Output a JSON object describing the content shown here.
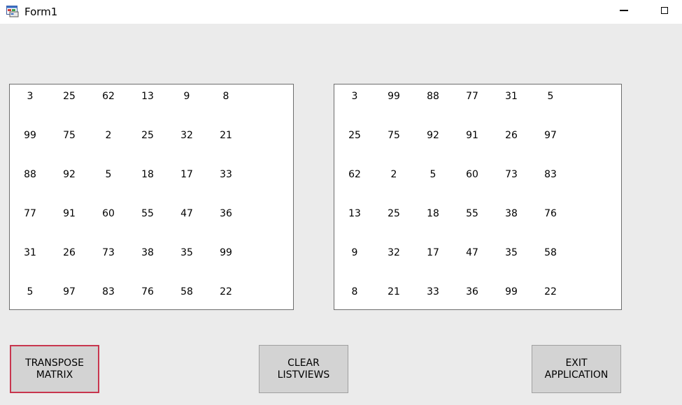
{
  "window": {
    "title": "Form1"
  },
  "left_listview": {
    "rows": [
      [
        "3",
        "25",
        "62",
        "13",
        "9",
        "8"
      ],
      [
        "99",
        "75",
        "2",
        "25",
        "32",
        "21"
      ],
      [
        "88",
        "92",
        "5",
        "18",
        "17",
        "33"
      ],
      [
        "77",
        "91",
        "60",
        "55",
        "47",
        "36"
      ],
      [
        "31",
        "26",
        "73",
        "38",
        "35",
        "99"
      ],
      [
        "5",
        "97",
        "83",
        "76",
        "58",
        "22"
      ]
    ]
  },
  "right_listview": {
    "rows": [
      [
        "3",
        "99",
        "88",
        "77",
        "31",
        "5"
      ],
      [
        "25",
        "75",
        "92",
        "91",
        "26",
        "97"
      ],
      [
        "62",
        "2",
        "5",
        "60",
        "73",
        "83"
      ],
      [
        "13",
        "25",
        "18",
        "55",
        "38",
        "76"
      ],
      [
        "9",
        "32",
        "17",
        "47",
        "35",
        "58"
      ],
      [
        "8",
        "21",
        "33",
        "36",
        "99",
        "22"
      ]
    ]
  },
  "buttons": {
    "transpose": {
      "line1": "TRANSPOSE",
      "line2": "MATRIX"
    },
    "clear": {
      "line1": "CLEAR",
      "line2": "LISTVIEWS"
    },
    "exit": {
      "line1": "EXIT",
      "line2": "APPLICATION"
    }
  },
  "colors": {
    "focus_border": "#c8364e",
    "window_bg": "#ebebeb",
    "button_bg": "#d3d3d3"
  }
}
